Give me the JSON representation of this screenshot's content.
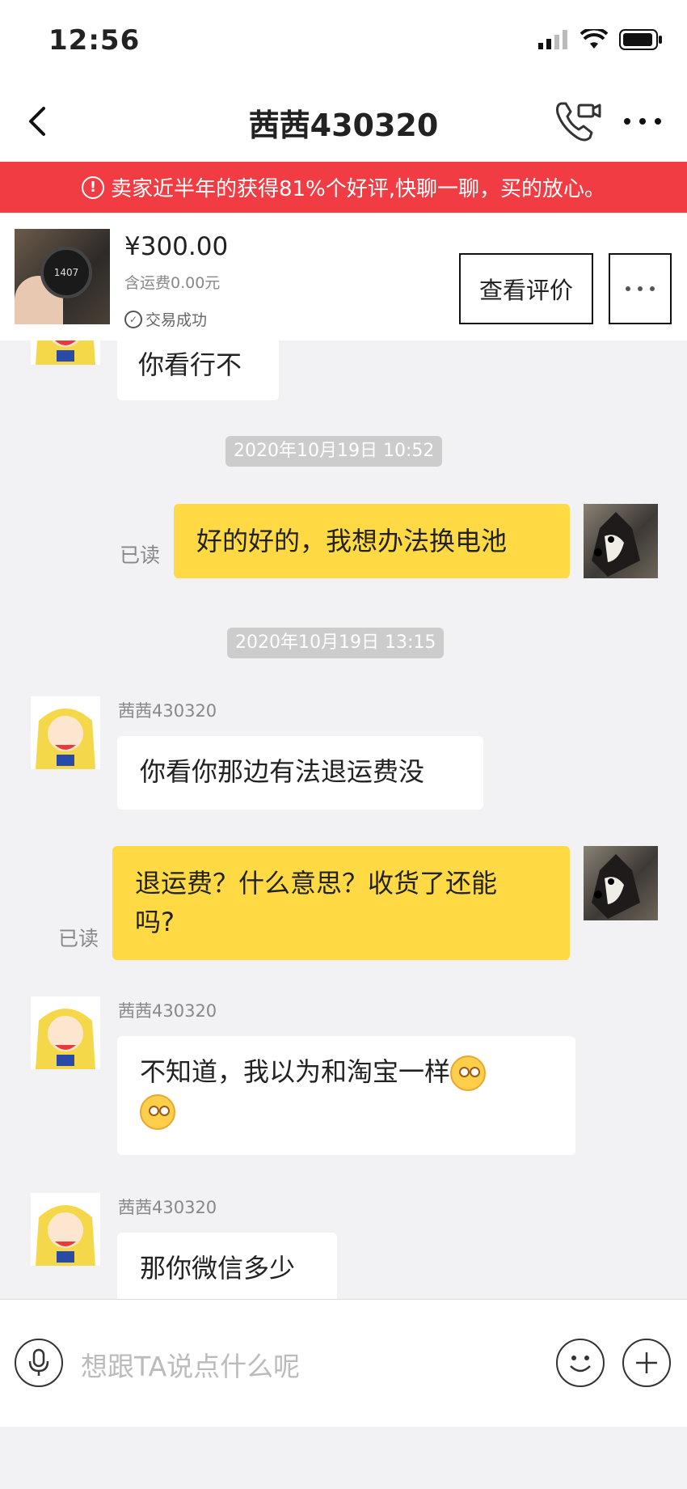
{
  "status_bar": {
    "time": "12:56"
  },
  "header": {
    "title": "茜茜430320"
  },
  "notice": {
    "text": "卖家近半年的获得81%个好评,快聊一聊，买的放心。"
  },
  "product": {
    "price": "¥300.00",
    "shipping": "含运费0.00元",
    "status": "交易成功",
    "watch_face": "1407",
    "review_button": "查看评价"
  },
  "chat": {
    "msg1": "你看行不",
    "ts1": "2020年10月19日 10:52",
    "msg2": "好的好的，我想办法换电池",
    "read_label": "已读",
    "ts2": "2020年10月19日 13:15",
    "sender": "茜茜430320",
    "msg3": "你看你那边有法退运费没",
    "msg4_line1": "退运费？什么意思？收货了还能",
    "msg4_line2": "吗?",
    "msg5": "不知道，我以为和淘宝一样",
    "msg6": "那你微信多少"
  },
  "input": {
    "placeholder": "想跟TA说点什么呢"
  },
  "colors": {
    "accent_yellow": "#ffda44",
    "notice_red": "#f23c44"
  }
}
